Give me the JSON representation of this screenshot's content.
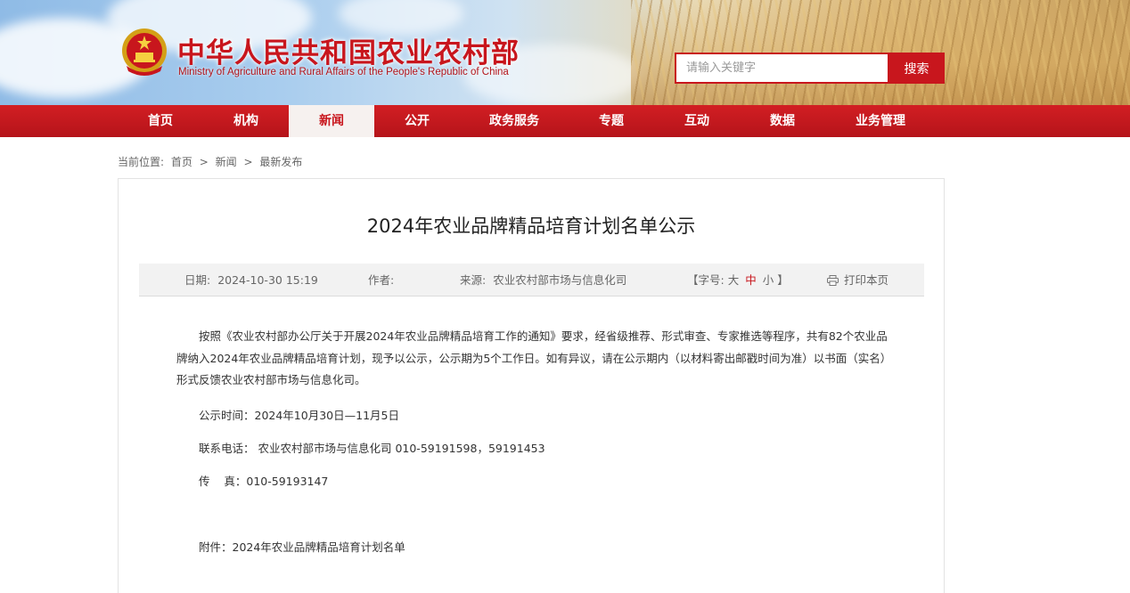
{
  "header": {
    "site_title": "中华人民共和国农业农村部",
    "site_subtitle": "Ministry of Agriculture and Rural Affairs of the People's Republic of China",
    "search_placeholder": "请输入关键字",
    "search_button": "搜索"
  },
  "nav": {
    "items": [
      {
        "label": "首页"
      },
      {
        "label": "机构"
      },
      {
        "label": "新闻"
      },
      {
        "label": "公开"
      },
      {
        "label": "政务服务"
      },
      {
        "label": "专题"
      },
      {
        "label": "互动"
      },
      {
        "label": "数据"
      },
      {
        "label": "业务管理"
      }
    ],
    "active": "新闻"
  },
  "breadcrumb": {
    "prefix": "当前位置:",
    "items": [
      "首页",
      "新闻",
      "最新发布"
    ],
    "separator": ">"
  },
  "article": {
    "title": "2024年农业品牌精品培育计划名单公示",
    "meta": {
      "date_label": "日期:",
      "date_value": "2024-10-30 15:19",
      "author_label": "作者:",
      "author_value": "",
      "source_label": "来源:",
      "source_value": "农业农村部市场与信息化司",
      "font_size_open": "【字号:",
      "font_large": "大",
      "font_medium": "中",
      "font_small": "小",
      "font_size_close": "】",
      "print_label": "打印本页"
    },
    "body": {
      "paragraph": "按照《农业农村部办公厅关于开展2024年农业品牌精品培育工作的通知》要求，经省级推荐、形式审查、专家推选等程序，共有82个农业品牌纳入2024年农业品牌精品培育计划，现予以公示，公示期为5个工作日。如有异议，请在公示期内（以材料寄出邮戳时间为准）以书面（实名）形式反馈农业农村部市场与信息化司。",
      "notice_time": "公示时间：2024年10月30日—11月5日",
      "contact": "联系电话： 农业农村部市场与信息化司  010-59191598，59191453",
      "fax": "传    真：010-59193147",
      "attachment": "附件：2024年农业品牌精品培育计划名单"
    }
  },
  "colors": {
    "brand_red": "#c8161d",
    "nav_active_bg": "#f6f1ef",
    "meta_bar_bg": "#f2f2f2"
  }
}
